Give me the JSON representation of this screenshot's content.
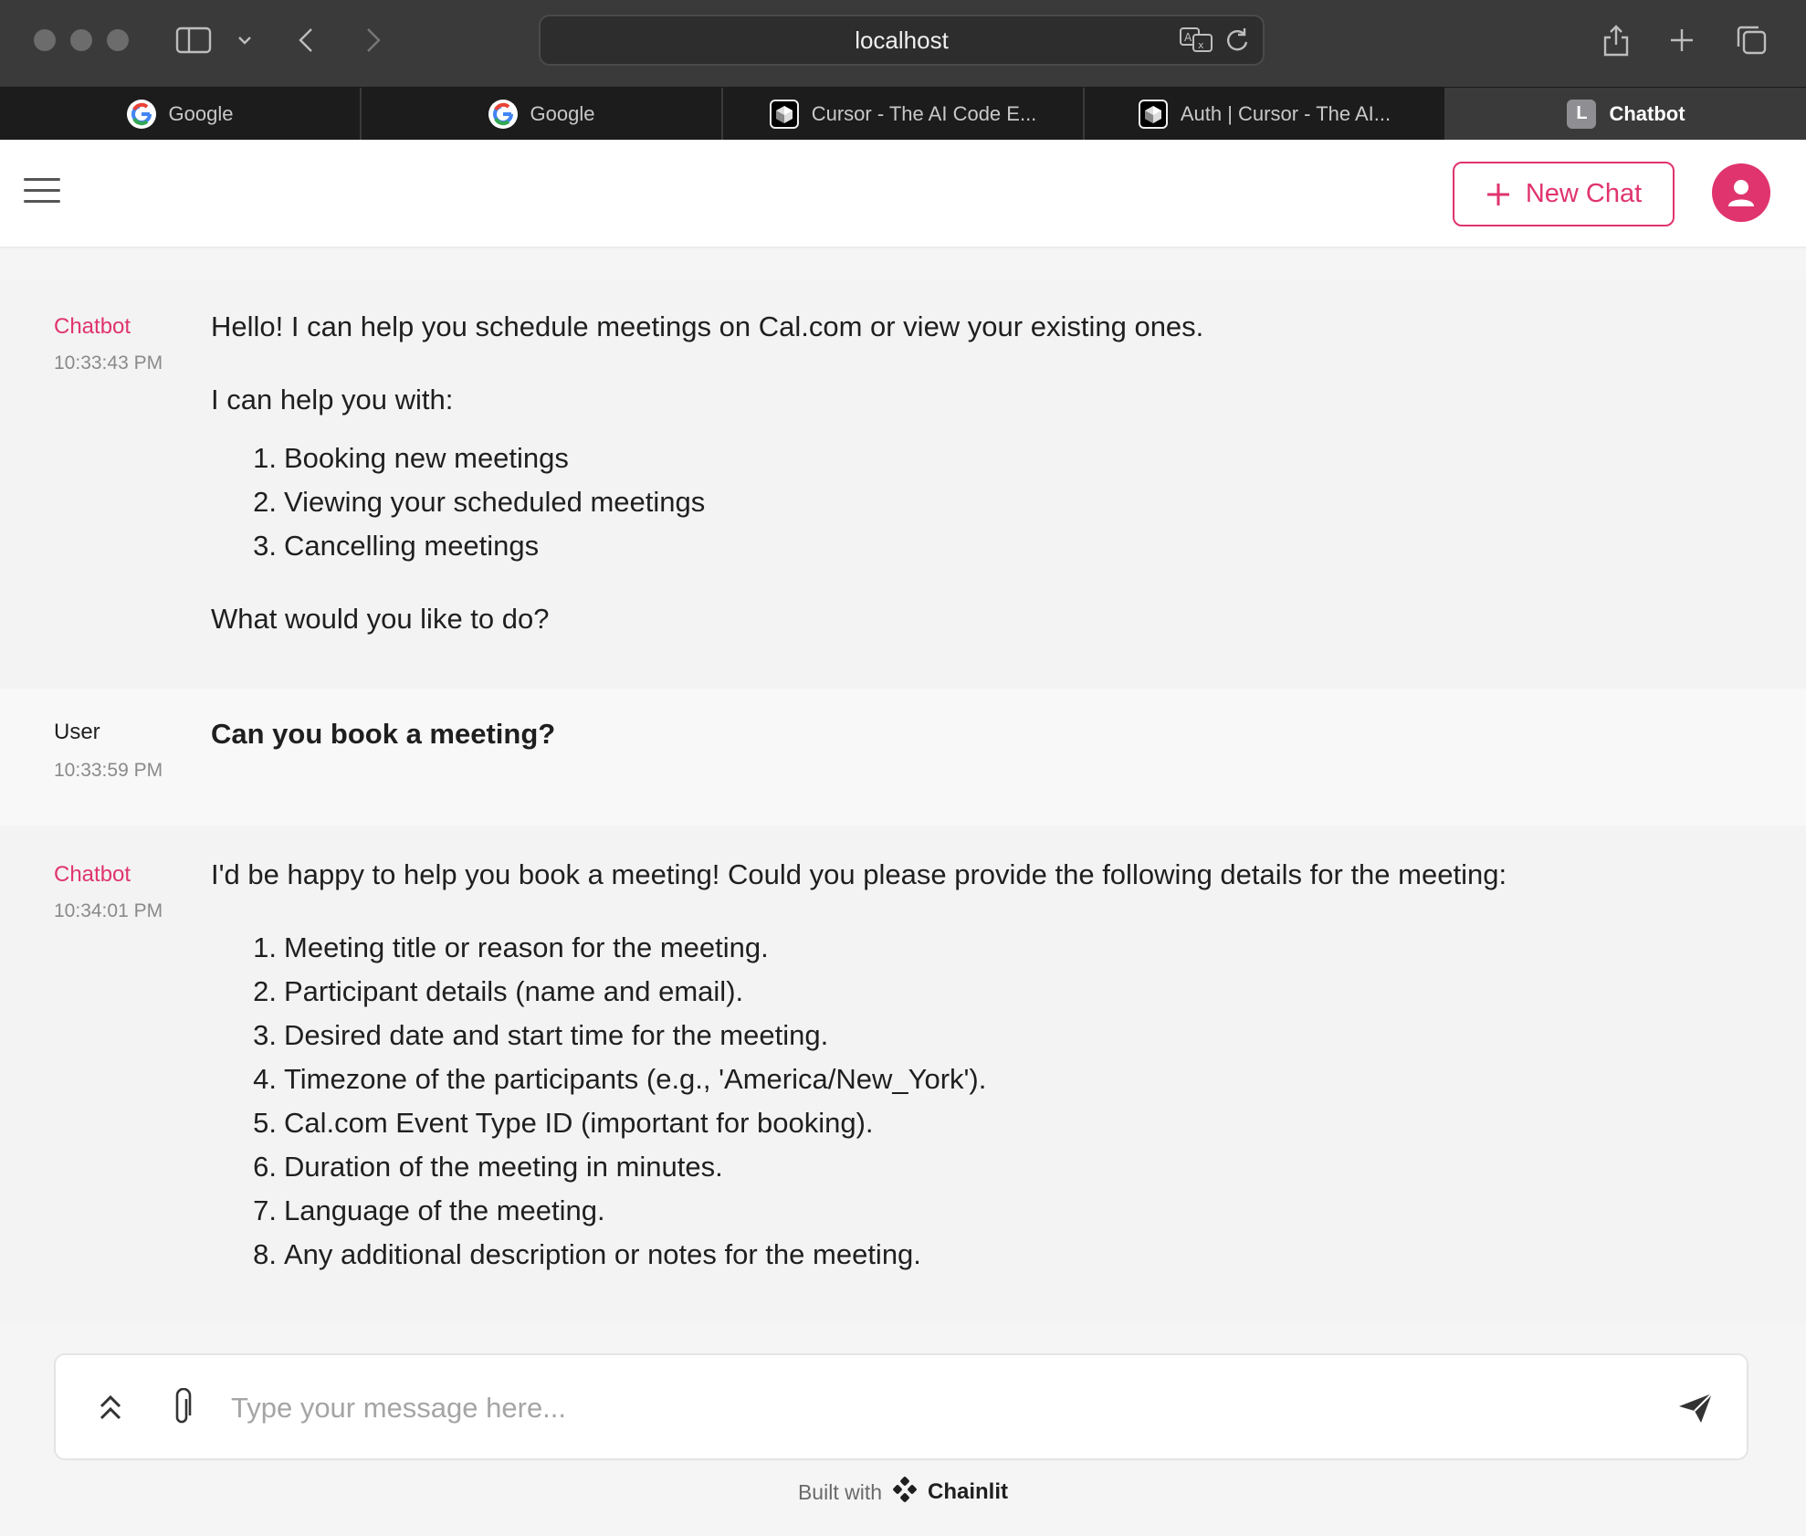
{
  "browser": {
    "url": "localhost",
    "tabs": [
      {
        "label": "Google",
        "icon": "google-icon",
        "active": false
      },
      {
        "label": "Google",
        "icon": "google-icon",
        "active": false
      },
      {
        "label": "Cursor - The AI Code E...",
        "icon": "cursor-icon",
        "active": false
      },
      {
        "label": "Auth | Cursor - The AI...",
        "icon": "cursor-icon",
        "active": false
      },
      {
        "label": "Chatbot",
        "icon": "letter-l-icon",
        "favicon_letter": "L",
        "active": true
      }
    ]
  },
  "header": {
    "new_chat_label": "New Chat",
    "accent_color": "#e0346e"
  },
  "messages": [
    {
      "author": "Chatbot",
      "time": "10:33:43 PM",
      "intro": "Hello! I can help you schedule meetings on Cal.com or view your existing ones.",
      "lead": "I can help you with:",
      "items": [
        "Booking new meetings",
        "Viewing your scheduled meetings",
        "Cancelling meetings"
      ],
      "outro": "What would you like to do?"
    },
    {
      "author": "User",
      "time": "10:33:59 PM",
      "text": "Can you book a meeting?"
    },
    {
      "author": "Chatbot",
      "time": "10:34:01 PM",
      "intro": "I'd be happy to help you book a meeting! Could you please provide the following details for the meeting:",
      "items": [
        "Meeting title or reason for the meeting.",
        "Participant details (name and email).",
        "Desired date and start time for the meeting.",
        "Timezone of the participants (e.g., 'America/New_York').",
        "Cal.com Event Type ID (important for booking).",
        "Duration of the meeting in minutes.",
        "Language of the meeting.",
        "Any additional description or notes for the meeting."
      ]
    }
  ],
  "composer": {
    "placeholder": "Type your message here..."
  },
  "footer": {
    "built_with": "Built with",
    "brand": "Chainlit"
  }
}
